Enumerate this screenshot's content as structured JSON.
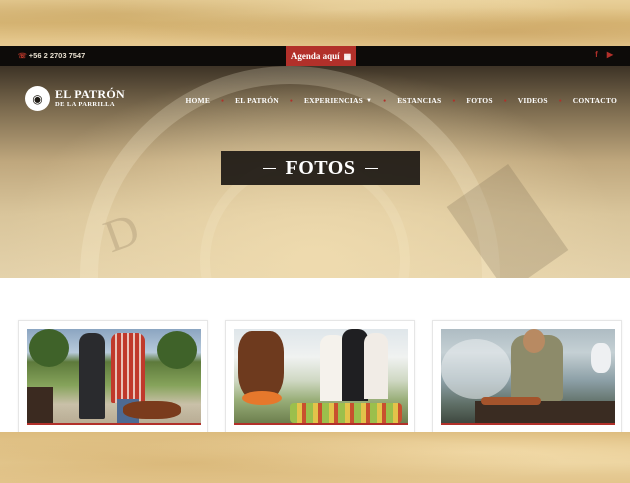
{
  "topbar": {
    "phone": "+56 2 2703 7547",
    "agenda_label": "Agenda aquí",
    "social": [
      "facebook-icon",
      "youtube-icon"
    ]
  },
  "logo": {
    "line1": "EL PATRÓN",
    "line2": "DE LA PARRILLA"
  },
  "nav": {
    "items": [
      {
        "label": "HOME"
      },
      {
        "label": "EL PATRÓN"
      },
      {
        "label": "EXPERIENCIAS"
      },
      {
        "label": "ESTANCIAS"
      },
      {
        "label": "FOTOS"
      },
      {
        "label": "VIDEOS"
      },
      {
        "label": "CONTACTO"
      }
    ]
  },
  "hero": {
    "title": "FOTOS"
  },
  "gallery": {
    "cards": [
      {
        "photo": "asado-outdoor-photo"
      },
      {
        "photo": "party-guests-photo"
      },
      {
        "photo": "grill-chef-photo"
      }
    ]
  },
  "colors": {
    "accent": "#b2302a",
    "topbar": "#0d0b09",
    "parchment": "#e0c486"
  }
}
